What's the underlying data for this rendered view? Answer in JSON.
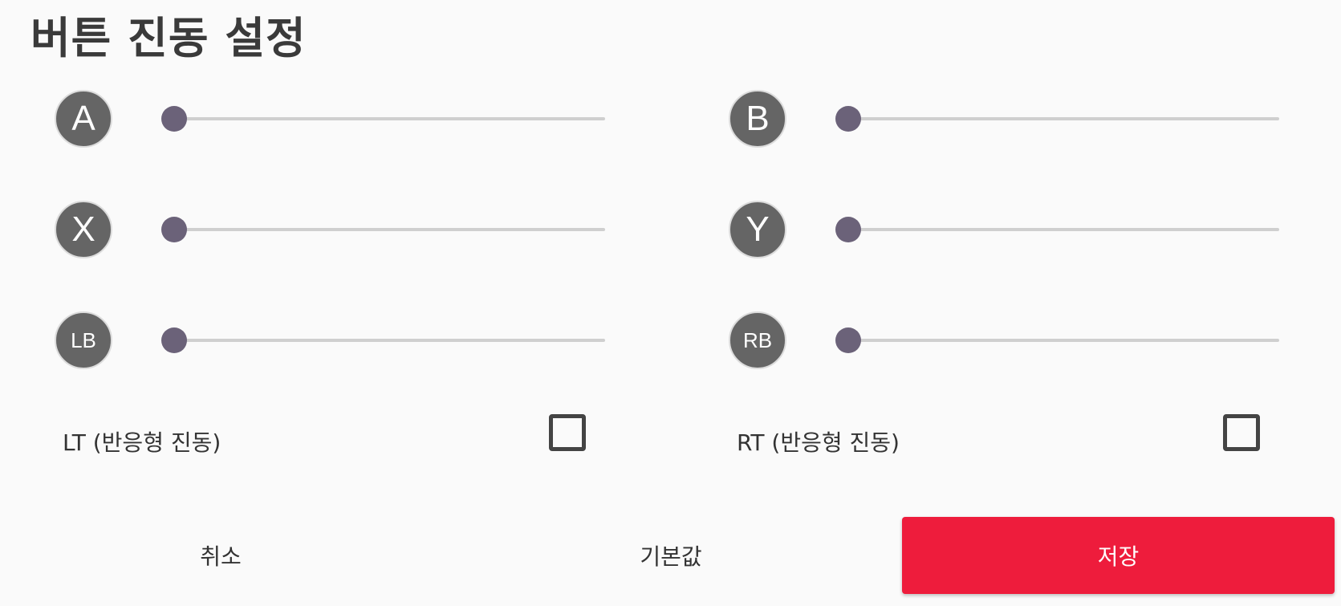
{
  "title": "버튼 진동 설정",
  "sliders": {
    "a": {
      "label": "A",
      "value": 0
    },
    "b": {
      "label": "B",
      "value": 0
    },
    "x": {
      "label": "X",
      "value": 0
    },
    "y": {
      "label": "Y",
      "value": 0
    },
    "lb": {
      "label": "LB",
      "value": 0
    },
    "rb": {
      "label": "RB",
      "value": 0
    }
  },
  "checkboxes": {
    "lt": {
      "label": "LT (반응형 진동)",
      "checked": false
    },
    "rt": {
      "label": "RT (반응형 진동)",
      "checked": false
    }
  },
  "footer": {
    "cancel": "취소",
    "default": "기본값",
    "save": "저장"
  },
  "colors": {
    "accent": "#ee1c3c",
    "thumb": "#6b6279",
    "badge": "#656565"
  }
}
